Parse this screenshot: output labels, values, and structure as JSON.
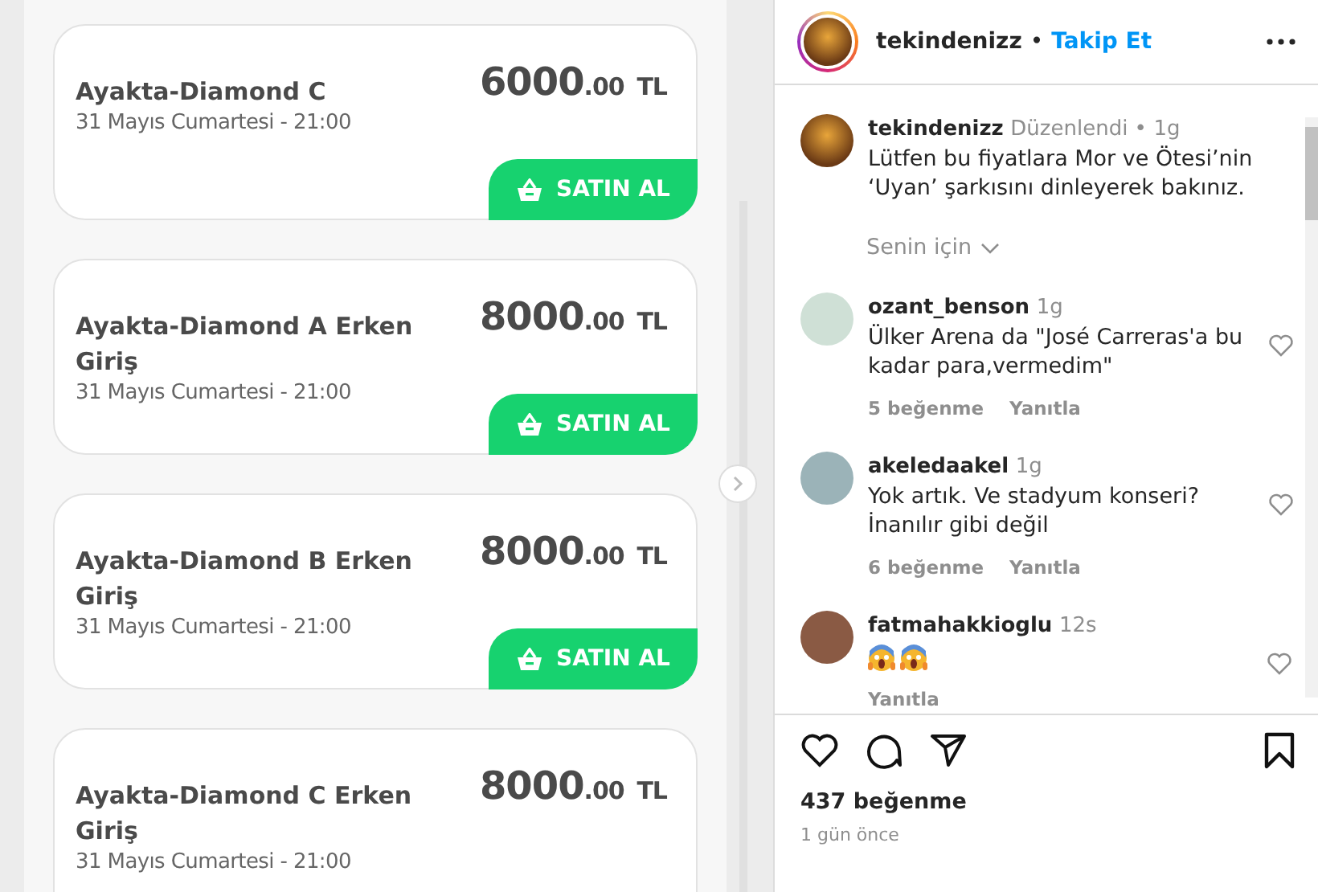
{
  "tickets": [
    {
      "name": "Ayakta-Diamond C",
      "date": "31 Mayıs Cumartesi - 21:00",
      "price": "6000",
      "cents": ".00",
      "currency": "TL",
      "button": "SATIN AL"
    },
    {
      "name": "Ayakta-Diamond A Erken Giriş",
      "date": "31 Mayıs Cumartesi - 21:00",
      "price": "8000",
      "cents": ".00",
      "currency": "TL",
      "button": "SATIN AL"
    },
    {
      "name": "Ayakta-Diamond B Erken Giriş",
      "date": "31 Mayıs Cumartesi - 21:00",
      "price": "8000",
      "cents": ".00",
      "currency": "TL",
      "button": "SATIN AL"
    },
    {
      "name": "Ayakta-Diamond C Erken Giriş",
      "date": "31 Mayıs Cumartesi - 21:00",
      "price": "8000",
      "cents": ".00",
      "currency": "TL"
    }
  ],
  "post": {
    "username": "tekindenizz",
    "separator": "•",
    "follow": "Takip Et",
    "caption": {
      "username": "tekindenizz",
      "edited": "Düzenlendi •",
      "time": "1g",
      "text": "Lütfen bu fiyatlara Mor ve Ötesi’nin ‘Uyan’ şarkısını dinleyerek bakınız."
    },
    "filter": "Senin için",
    "comments": [
      {
        "username": "ozant_benson",
        "time": "1g",
        "text": "Ülker Arena da \"José Carreras'a bu kadar para,vermedim\"",
        "likes": "5 beğenme",
        "reply": "Yanıtla"
      },
      {
        "username": "akeledaakel",
        "time": "1g",
        "text": "Yok artık. Ve stadyum konseri? İnanılır gibi değil",
        "likes": "6 beğenme",
        "reply": "Yanıtla"
      },
      {
        "username": "fatmahakkioglu",
        "time": "12s",
        "reactions": [
          {
            "kind": "scream"
          },
          {
            "kind": "scream"
          }
        ],
        "reply": "Yanıtla"
      }
    ],
    "likes": "437 beğenme",
    "posted": "1 gün önce"
  }
}
